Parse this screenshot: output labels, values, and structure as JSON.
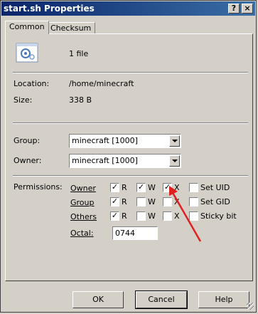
{
  "window": {
    "title": "start.sh Properties",
    "help_glyph": "?",
    "close_glyph": "×"
  },
  "tabs": [
    {
      "label": "Common",
      "selected": true
    },
    {
      "label": "Checksum",
      "selected": false
    }
  ],
  "summary": {
    "icon": "properties-icon",
    "count_text": "1 file"
  },
  "location": {
    "label": "Location:",
    "value": "/home/minecraft"
  },
  "size": {
    "label": "Size:",
    "value": "338 B"
  },
  "group": {
    "label": "Group:",
    "value": "minecraft [1000]"
  },
  "owner": {
    "label": "Owner:",
    "value": "minecraft [1000]"
  },
  "permissions": {
    "label": "Permissions:",
    "rows": [
      {
        "name": "Owner",
        "r": true,
        "w": true,
        "x": true,
        "special_label": "Set UID",
        "special": false
      },
      {
        "name": "Group",
        "r": true,
        "w": false,
        "x": false,
        "special_label": "Set GID",
        "special": false
      },
      {
        "name": "Others",
        "r": true,
        "w": false,
        "x": false,
        "special_label": "Sticky bit",
        "special": false
      }
    ],
    "r_label": "R",
    "w_label": "W",
    "x_label": "X",
    "check_glyph": "✓"
  },
  "octal": {
    "label": "Octal:",
    "value": "0744"
  },
  "buttons": {
    "ok": "OK",
    "cancel": "Cancel",
    "help": "Help"
  },
  "colors": {
    "titlebar_start": "#0a246a",
    "titlebar_end": "#3a6ea5",
    "annotation_arrow": "#e02020"
  }
}
